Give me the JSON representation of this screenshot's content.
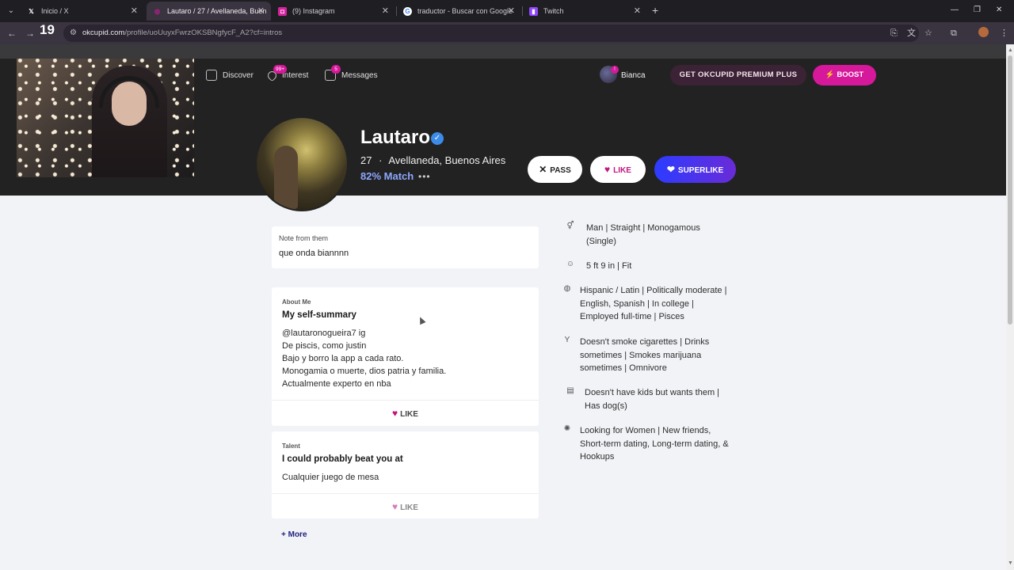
{
  "browser": {
    "tabs": [
      {
        "title": "Inicio / X",
        "favicon": "x-logo-icon"
      },
      {
        "title": "Lautaro / 27 / Avellaneda, Buen",
        "favicon": "okcupid-icon"
      },
      {
        "title": "(9) Instagram",
        "favicon": "instagram-icon"
      },
      {
        "title": "traductor - Buscar con Google",
        "favicon": "google-icon"
      },
      {
        "title": "Twitch",
        "favicon": "twitch-icon"
      }
    ],
    "url_host": "okcupid.com",
    "url_path": "/profile/uoUuyxFwrzOKSBNgfycF_A2?cf=intros",
    "overlay_number": "19"
  },
  "nav": {
    "discover": "Discover",
    "interest": "Interest",
    "interest_badge": "99+",
    "messages": "Messages",
    "messages_badge": "5",
    "user_name": "Bianca",
    "user_badge": "!",
    "premium_label": "GET OKCUPID PREMIUM PLUS",
    "boost_label": "⚡ BOOST"
  },
  "profile": {
    "name": "Lautaro",
    "age": "27",
    "separator": "·",
    "location": "Avellaneda, Buenos Aires",
    "match": "82% Match",
    "more_dots": "•••",
    "pass_label": "PASS",
    "like_label": "LIKE",
    "superlike_label": "SUPERLIKE"
  },
  "note": {
    "label": "Note from them",
    "text": "que onda biannnn"
  },
  "about": {
    "label": "About Me",
    "title": "My self-summary",
    "body": "@lautaronogueira7 ig\nDe piscis, como justin\nBajo y borro la app a cada rato.\nMonogamia o muerte, dios patria y familia.\nActualmente experto en nba",
    "like_label": "LIKE"
  },
  "talent": {
    "label": "Talent",
    "title": "I could probably beat you at",
    "body": "Cualquier juego de mesa",
    "like_label": "LIKE"
  },
  "more_label": "+ More",
  "details": [
    {
      "icon": "gender-icon",
      "text": "Man | Straight | Monogamous (Single)"
    },
    {
      "icon": "body-icon",
      "text": "5 ft 9 in | Fit"
    },
    {
      "icon": "background-icon",
      "text": "Hispanic / Latin | Politically moderate | English, Spanish | In college | Employed full-time | Pisces"
    },
    {
      "icon": "drink-icon",
      "text": "Doesn't smoke cigarettes | Drinks sometimes | Smokes marijuana sometimes | Omnivore"
    },
    {
      "icon": "family-icon",
      "text": "Doesn't have kids but wants them | Has dog(s)"
    },
    {
      "icon": "looking-for-icon",
      "text": "Looking for Women | New friends, Short-term dating, Long-term dating, & Hookups"
    }
  ],
  "colors": {
    "brand_pink": "#d6189b",
    "match_blue": "#8ea7ff",
    "header_bg": "#222222"
  }
}
